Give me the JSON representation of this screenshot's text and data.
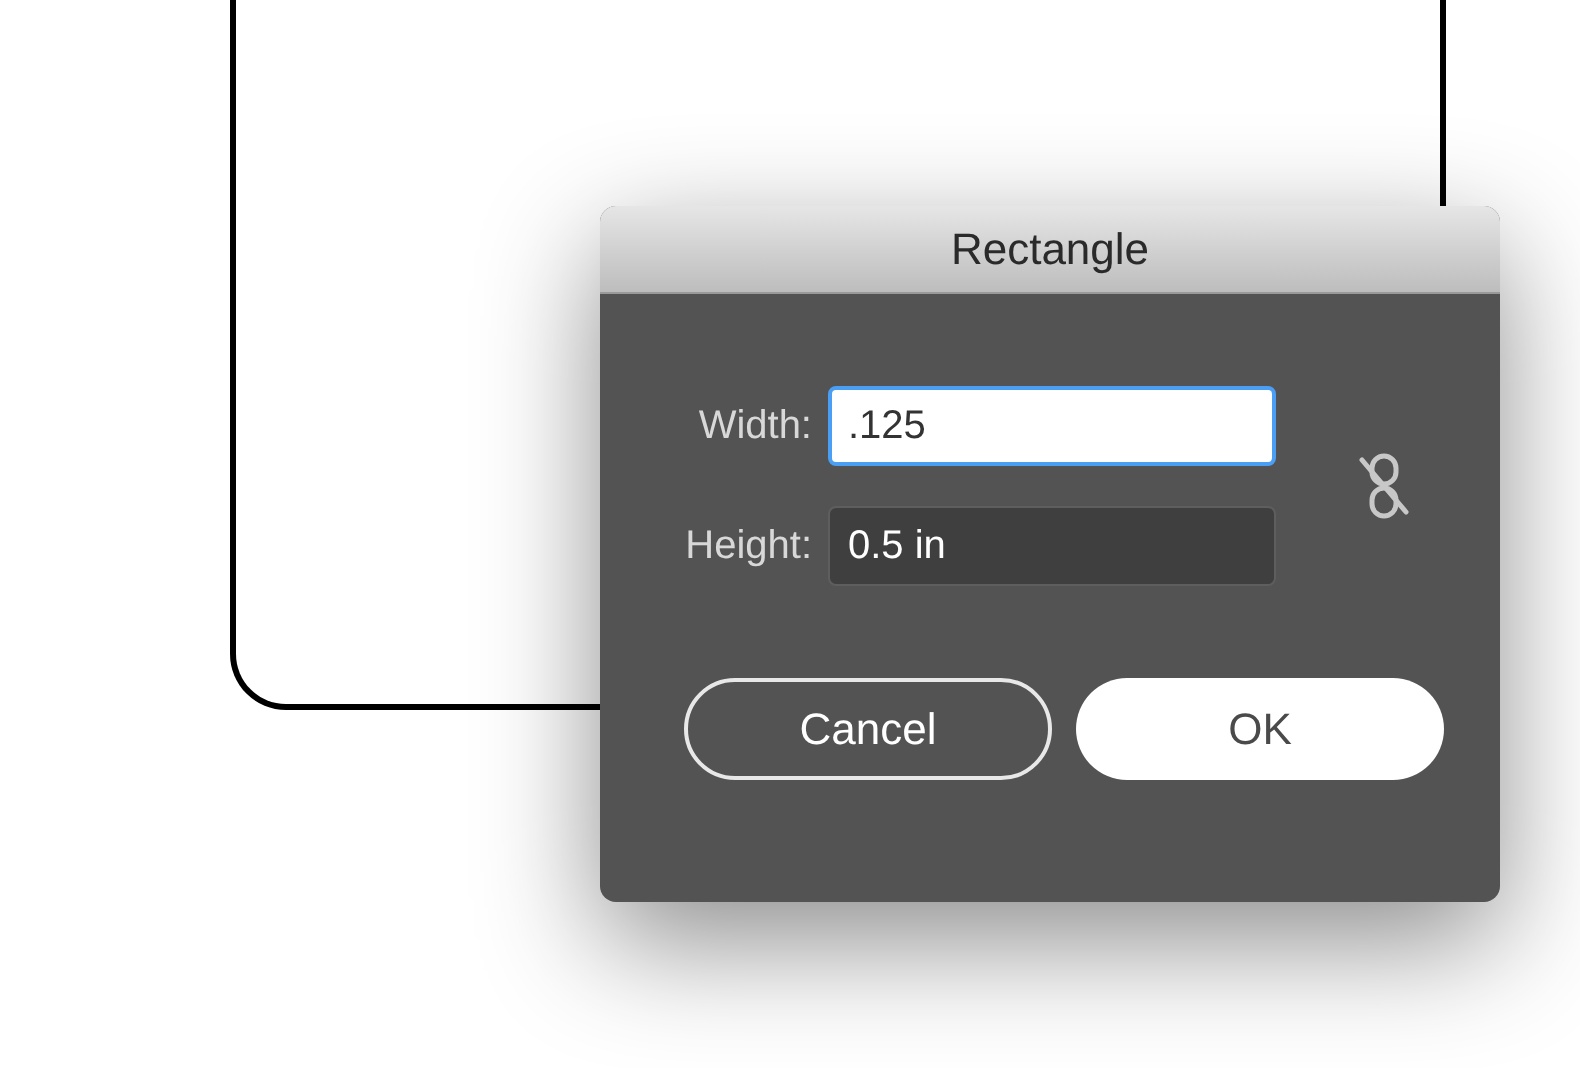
{
  "dialog": {
    "title": "Rectangle",
    "fields": [
      {
        "label": "Width:",
        "value": ".125",
        "focused": true
      },
      {
        "label": "Height:",
        "value": "0.5 in",
        "focused": false
      }
    ],
    "constrain_proportions": {
      "linked": false
    },
    "buttons": [
      {
        "label": "Cancel",
        "kind": "secondary"
      },
      {
        "label": "OK",
        "kind": "primary"
      }
    ]
  }
}
